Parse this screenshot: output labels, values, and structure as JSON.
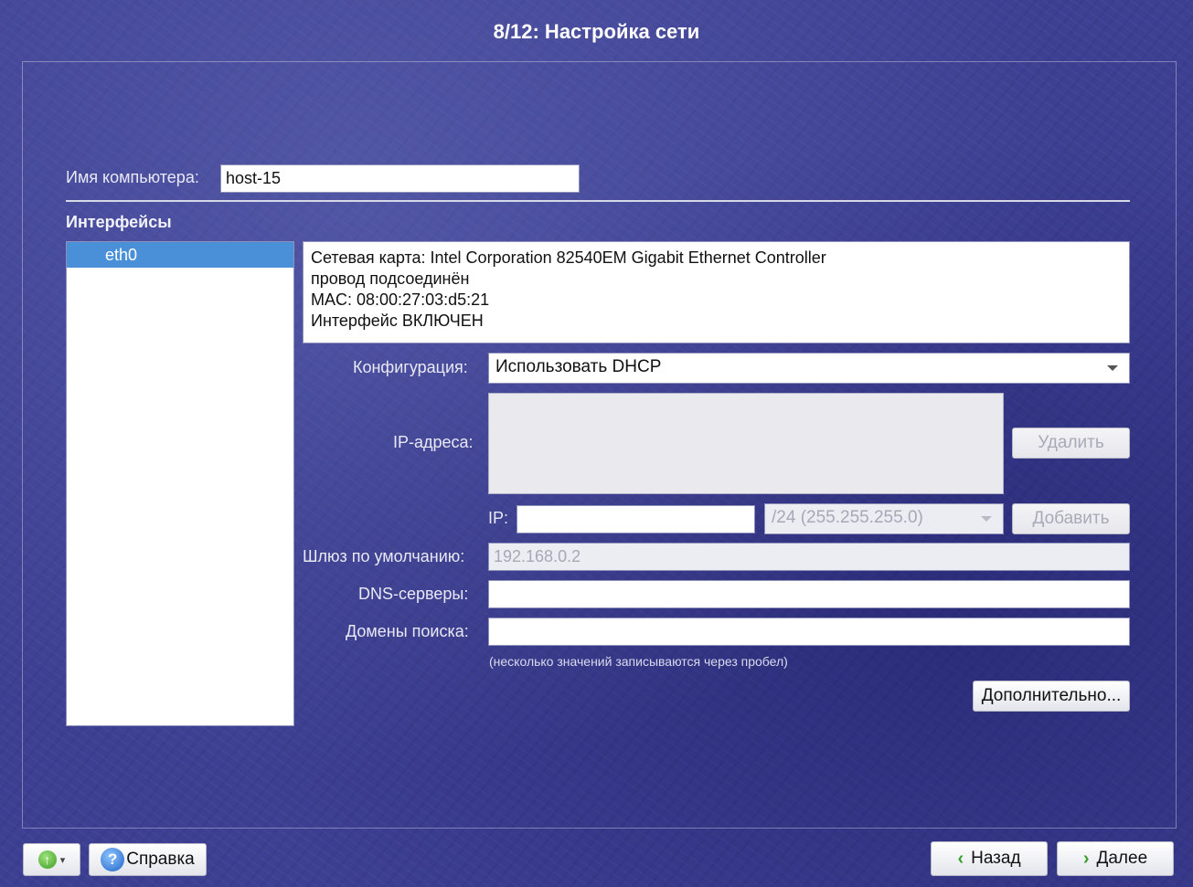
{
  "window": {
    "title": "8/12: Настройка сети"
  },
  "hostname": {
    "label": "Имя компьютера:",
    "value": "host-15"
  },
  "interfaces": {
    "title": "Интерфейсы",
    "items": [
      {
        "label": "eth0",
        "selected": true
      }
    ]
  },
  "info": {
    "lines": [
      "Сетевая карта: Intel Corporation 82540EM Gigabit Ethernet Controller",
      "провод подсоединён",
      "MAC: 08:00:27:03:d5:21",
      "Интерфейс ВКЛЮЧЕН"
    ]
  },
  "config": {
    "label": "Конфигурация:",
    "value": "Использовать DHCP"
  },
  "ip_addresses": {
    "label": "IP-адреса:",
    "delete_label": "Удалить"
  },
  "ip": {
    "label": "IP:",
    "value": "",
    "mask": "/24 (255.255.255.0)",
    "add_label": "Добавить"
  },
  "gateway": {
    "label": "Шлюз по умолчанию:",
    "value": "192.168.0.2"
  },
  "dns": {
    "label": "DNS-серверы:",
    "value": ""
  },
  "search_domains": {
    "label": "Домены поиска:",
    "value": ""
  },
  "hint": "(несколько значений записываются через пробел)",
  "advanced_label": "Дополнительно...",
  "footer": {
    "help_label": "Справка",
    "back_label": "Назад",
    "next_label": "Далее"
  },
  "colors": {
    "background": "#3d3f92",
    "selection": "#4a90d9",
    "accent_green": "#3f9c22"
  }
}
